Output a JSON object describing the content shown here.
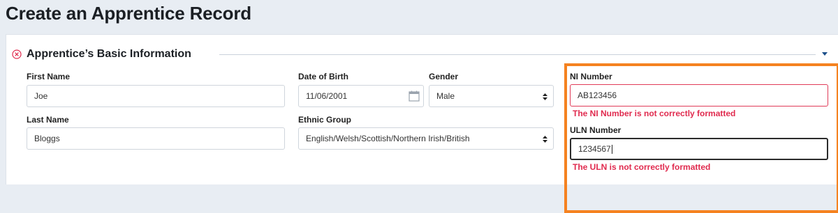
{
  "page": {
    "title": "Create an Apprentice Record"
  },
  "section": {
    "title": "Apprentice’s Basic Information"
  },
  "form": {
    "first_name": {
      "label": "First Name",
      "value": "Joe"
    },
    "last_name": {
      "label": "Last Name",
      "value": "Bloggs"
    },
    "dob": {
      "label": "Date of Birth",
      "value": "11/06/2001"
    },
    "gender": {
      "label": "Gender",
      "value": "Male"
    },
    "ethnic_group": {
      "label": "Ethnic Group",
      "value": "English/Welsh/Scottish/Northern Irish/British"
    },
    "ni_number": {
      "label": "NI Number",
      "value": "AB123456",
      "error": "The NI Number is not correctly formatted"
    },
    "uln_number": {
      "label": "ULN Number",
      "value": "1234567",
      "error": "The ULN is not correctly formatted"
    }
  },
  "colors": {
    "error": "#e02a4e",
    "highlight": "#f58220",
    "accent": "#1c4f8a"
  },
  "icons": [
    "collapse-icon",
    "caret-down-icon",
    "calendar-icon",
    "select-arrows-icon"
  ]
}
